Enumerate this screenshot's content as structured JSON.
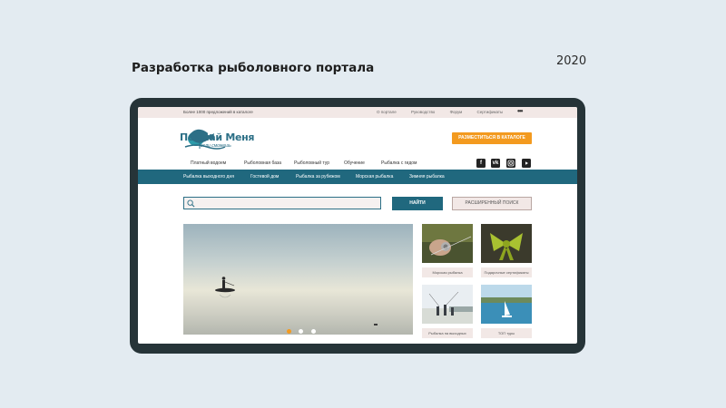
{
  "heading": "Разработка рыболовного портала",
  "year": "2020",
  "site": {
    "topbar": {
      "tagline": "Более 1000 предложений в каталоге",
      "links": [
        "О портале",
        "Руководство",
        "Форум",
        "Сертификаты"
      ],
      "more": "•••"
    },
    "logo": {
      "title": "Поймай Меня",
      "subtitle": "если сможешь"
    },
    "cta_label": "РАЗМЕСТИТЬСЯ В КАТАЛОГЕ",
    "main_nav": [
      "Платный водоем",
      "Рыболовная база",
      "Рыболовный тур",
      "Обучение",
      "Рыбалка с гидом"
    ],
    "social": [
      "facebook-icon",
      "vk-icon",
      "instagram-icon",
      "youtube-icon"
    ],
    "sub_nav": [
      "Рыбалка выходного дня",
      "Гостевой дом",
      "Рыбалка за рубежом",
      "Морская рыбалка",
      "Зимняя рыбалка"
    ],
    "search": {
      "placeholder": "",
      "button": "НАЙТИ",
      "advanced": "РАСШИРЕННЫЙ ПОИСК"
    },
    "slider": {
      "total": 3,
      "active": 1
    },
    "cards": [
      {
        "label": "Морская рыбалка",
        "image": "hands-with-fishing-reel"
      },
      {
        "label": "Подарочные сертификаты",
        "image": "gift-bow"
      },
      {
        "label": "Рыбалка на выходных",
        "image": "group-fishing-on-shore"
      },
      {
        "label": "ТОП туры",
        "image": "sailboat-on-lake"
      }
    ],
    "colors": {
      "accent": "#f39a1f",
      "primary": "#20687e",
      "frame": "#263438",
      "background": "#e3ebf1"
    }
  }
}
